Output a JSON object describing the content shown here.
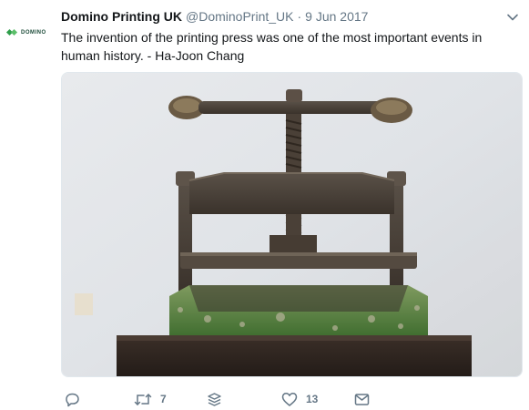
{
  "account": {
    "name": "Domino Printing UK",
    "handle": "@DominoPrint_UK",
    "separator": "·",
    "date": "9 Jun 2017",
    "avatar_brand": "DOMINO"
  },
  "tweet": {
    "text": "The invention of the printing press was one of the most important events in human history. - Ha-Joon Chang"
  },
  "actions": {
    "reply_count": "",
    "retweet_count": "7",
    "like_count": "13"
  },
  "icons": {
    "menu": "chevron-down-icon",
    "reply": "reply-icon",
    "retweet": "retweet-icon",
    "stack": "stack-icon",
    "like": "heart-icon",
    "message": "envelope-icon"
  },
  "colors": {
    "text": "#14171a",
    "muted": "#657786",
    "brand_green": "#2e9e4b"
  }
}
